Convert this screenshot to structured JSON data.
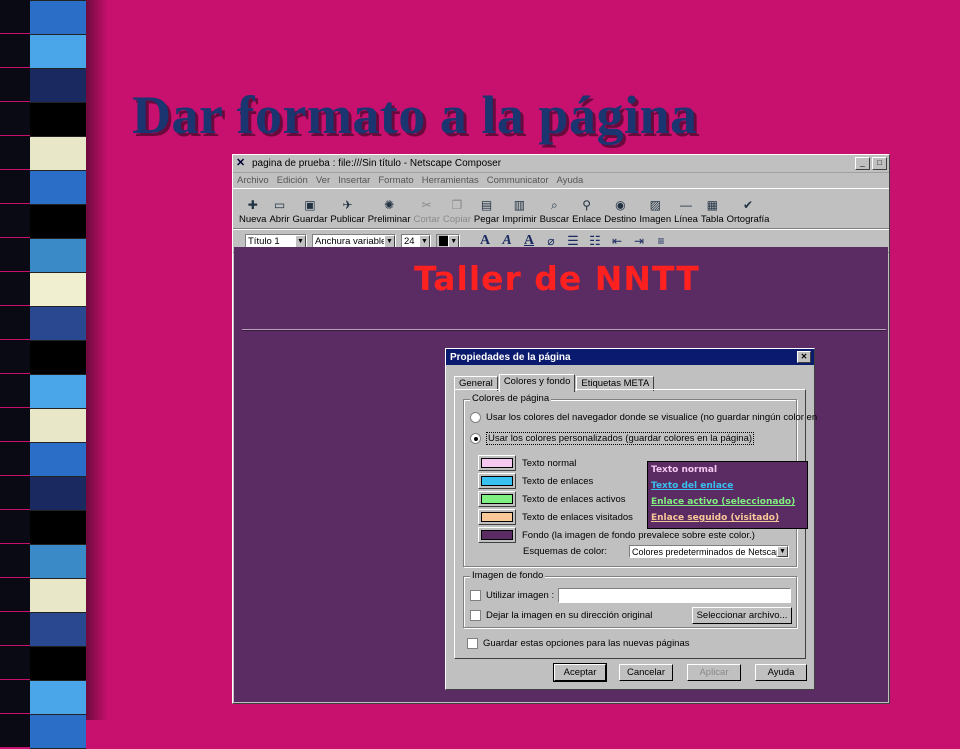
{
  "slide": {
    "title": "Dar formato a la página"
  },
  "window": {
    "title": "pagina de prueba : file:///Sin título - Netscape Composer",
    "menu": [
      "Archivo",
      "Edición",
      "Ver",
      "Insertar",
      "Formato",
      "Herramientas",
      "Communicator",
      "Ayuda"
    ],
    "toolbar": [
      {
        "label": "Nueva",
        "icon": "new-page-icon",
        "enabled": true
      },
      {
        "label": "Abrir",
        "icon": "open-folder-icon",
        "enabled": true
      },
      {
        "label": "Guardar",
        "icon": "save-disk-icon",
        "enabled": true
      },
      {
        "label": "Publicar",
        "icon": "publish-icon",
        "enabled": true
      },
      {
        "label": "Preliminar",
        "icon": "preview-icon",
        "enabled": true
      },
      {
        "label": "Cortar",
        "icon": "scissors-icon",
        "enabled": false
      },
      {
        "label": "Copiar",
        "icon": "copy-icon",
        "enabled": false
      },
      {
        "label": "Pegar",
        "icon": "paste-icon",
        "enabled": true
      },
      {
        "label": "Imprimir",
        "icon": "printer-icon",
        "enabled": true
      },
      {
        "label": "Buscar",
        "icon": "find-icon",
        "enabled": true
      },
      {
        "label": "Enlace",
        "icon": "link-icon",
        "enabled": true
      },
      {
        "label": "Destino",
        "icon": "target-icon",
        "enabled": true
      },
      {
        "label": "Imagen",
        "icon": "image-icon",
        "enabled": true
      },
      {
        "label": "Línea",
        "icon": "line-icon",
        "enabled": true
      },
      {
        "label": "Tabla",
        "icon": "table-icon",
        "enabled": true
      },
      {
        "label": "Ortografía",
        "icon": "spellcheck-icon",
        "enabled": true
      }
    ],
    "format": {
      "paragraph_style": "Título 1",
      "font": "Anchura variable",
      "size": "24"
    },
    "heading": "Taller de NNTT"
  },
  "dialog": {
    "title": "Propiedades de la página",
    "tabs": [
      "General",
      "Colores y fondo",
      "Etiquetas META"
    ],
    "active_tab": "Colores y fondo",
    "colors_group": "Colores de página",
    "option_browser": "Usar los colores del navegador donde se visualice (no guardar ningún color en",
    "option_custom": "Usar los colores personalizados (guardar colores en la página)",
    "color_rows": [
      {
        "label": "Texto normal",
        "color": "#f4c8f0"
      },
      {
        "label": "Texto de enlaces",
        "color": "#38c0f0"
      },
      {
        "label": "Texto de enlaces activos",
        "color": "#80f080"
      },
      {
        "label": "Texto de enlaces visitados",
        "color": "#f8c898"
      },
      {
        "label": "Fondo (la imagen de fondo prevalece sobre este color.)",
        "color": "#5b2c64"
      }
    ],
    "preview": [
      {
        "text": "Texto normal",
        "color": "#f4c8f0"
      },
      {
        "text": "Texto del enlace",
        "color": "#38c0f0"
      },
      {
        "text": "Enlace activo (seleccionado)",
        "color": "#80f080"
      },
      {
        "text": "Enlace seguido (visitado)",
        "color": "#f8c898"
      }
    ],
    "schemes_label": "Esquemas de color:",
    "schemes_value": "Colores predeterminados de Netscape",
    "bg_group": "Imagen de fondo",
    "use_image": "Utilizar imagen :",
    "keep_image": "Dejar la imagen en su dirección original",
    "select_file": "Seleccionar archivo...",
    "save_options": "Guardar estas opciones para las nuevas páginas",
    "buttons": {
      "ok": "Aceptar",
      "cancel": "Cancelar",
      "apply": "Aplicar",
      "help": "Ayuda"
    }
  }
}
